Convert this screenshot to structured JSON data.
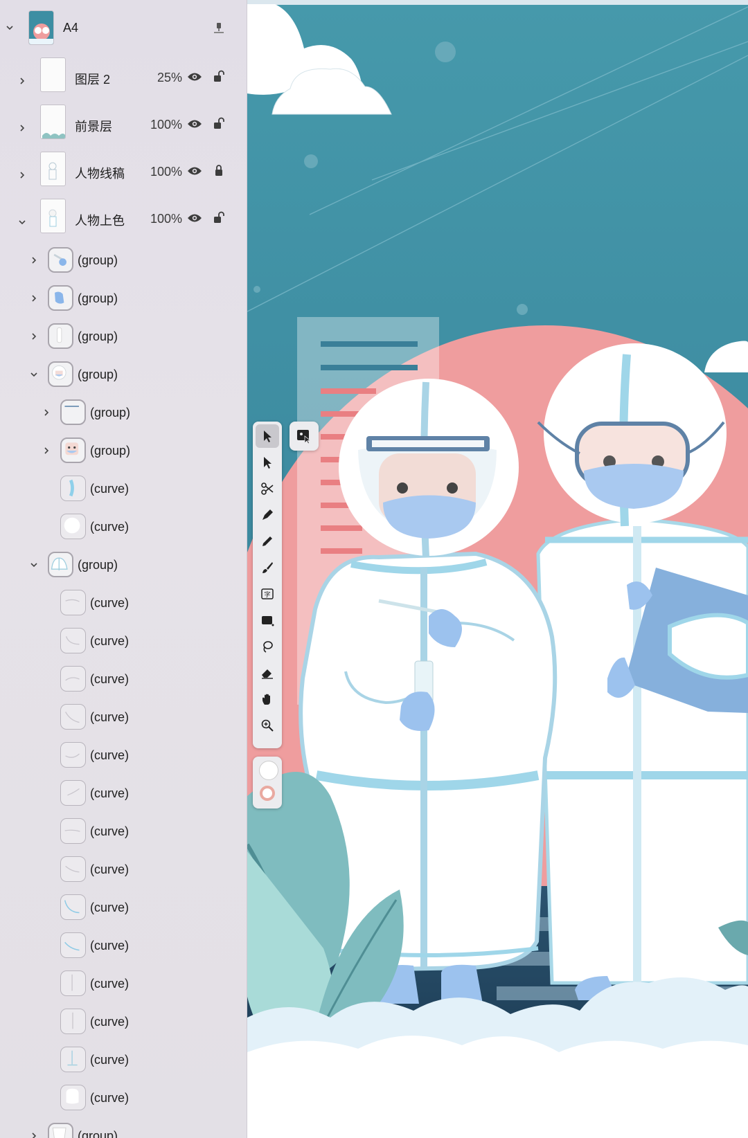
{
  "document": {
    "name": "A4"
  },
  "layers": [
    {
      "name": "图层 2",
      "opacity": "25%"
    },
    {
      "name": "前景层",
      "opacity": "100%"
    },
    {
      "name": "人物线稿",
      "opacity": "100%"
    },
    {
      "name": "人物上色",
      "opacity": "100%"
    }
  ],
  "tree": [
    {
      "label": "(group)"
    },
    {
      "label": "(group)"
    },
    {
      "label": "(group)"
    },
    {
      "label": "(group)"
    },
    {
      "label": "(group)"
    },
    {
      "label": "(group)"
    },
    {
      "label": "(curve)"
    },
    {
      "label": "(curve)"
    },
    {
      "label": "(group)"
    },
    {
      "label": "(curve)"
    },
    {
      "label": "(curve)"
    },
    {
      "label": "(curve)"
    },
    {
      "label": "(curve)"
    },
    {
      "label": "(curve)"
    },
    {
      "label": "(curve)"
    },
    {
      "label": "(curve)"
    },
    {
      "label": "(curve)"
    },
    {
      "label": "(curve)"
    },
    {
      "label": "(curve)"
    },
    {
      "label": "(curve)"
    },
    {
      "label": "(curve)"
    },
    {
      "label": "(curve)"
    },
    {
      "label": "(curve)"
    },
    {
      "label": "(group)"
    }
  ],
  "tools": [
    "select-arrow-icon",
    "direct-select-icon",
    "scissors-icon",
    "pen-icon",
    "pencil-icon",
    "brush-icon",
    "text-icon",
    "rectangle-icon",
    "lasso-icon",
    "eraser-icon",
    "hand-icon",
    "zoom-icon"
  ],
  "colors": {
    "accent_teal": "#3f8fa3",
    "pink": "#ef9d9e",
    "suit_outline": "#9fcfe0",
    "mask_blue": "#a9c9f0"
  }
}
